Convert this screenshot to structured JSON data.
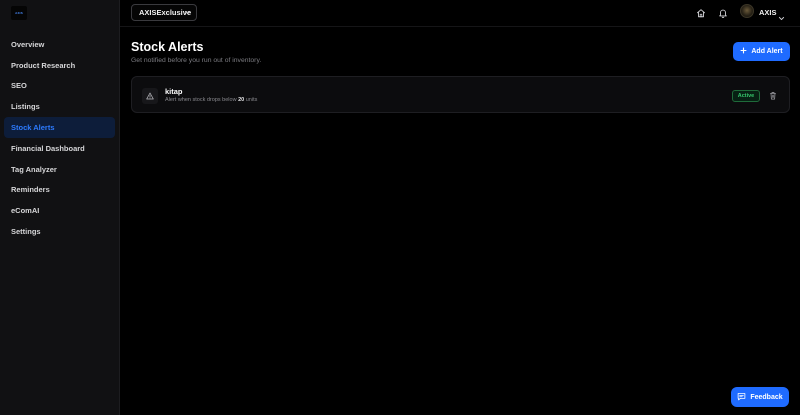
{
  "logo": {
    "text": "AXIS"
  },
  "sidebar": {
    "items": [
      {
        "label": "Overview"
      },
      {
        "label": "Product Research"
      },
      {
        "label": "SEO"
      },
      {
        "label": "Listings"
      },
      {
        "label": "Stock Alerts"
      },
      {
        "label": "Financial Dashboard"
      },
      {
        "label": "Tag Analyzer"
      },
      {
        "label": "Reminders"
      },
      {
        "label": "eComAI"
      },
      {
        "label": "Settings"
      }
    ]
  },
  "topbar": {
    "shop_selected": "AXISExclusive",
    "user_name": "AXIS"
  },
  "main": {
    "title": "Stock Alerts",
    "subtitle": "Get notified before you run out of inventory.",
    "add_button": "Add Alert"
  },
  "alerts": [
    {
      "name": "kitap",
      "desc_prefix": "Alert when stock drops below",
      "threshold": "20",
      "desc_suffix": "units",
      "status": "Active"
    }
  ],
  "feedback_button": "Feedback",
  "colors": {
    "accent": "#1f6bff",
    "active_nav_text": "#2d7bff",
    "active_badge": "#35c46b",
    "background": "#000000",
    "sidebar_bg": "#111113"
  },
  "icons": {
    "home": "home-icon",
    "bell": "bell-icon",
    "plus": "plus-icon",
    "warning": "warning-icon",
    "trash": "trash-icon",
    "chat": "chat-icon",
    "chevron": "chevron-down-icon"
  }
}
